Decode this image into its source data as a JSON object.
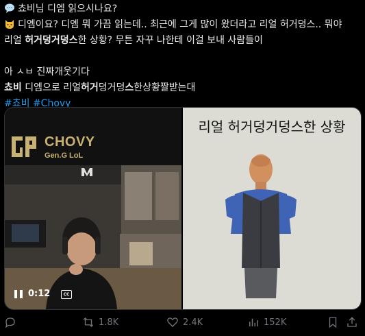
{
  "tweet": {
    "line1": "쵸비님 디엠 읽으시나요?",
    "line2": "디엠이요? 디엠 뭐 가끔 읽는데.. 최근에 그게 많이 왔더라고 리얼 허거덩스.. 뭐야",
    "line3_pre": "리얼 ",
    "line3_bold": "허거덩거덩스",
    "line3_post": "한 상황? 무튼 자꾸 나한테 이걸 보내 사람들이",
    "line4": "아 ㅅㅂ 진짜개웃기다",
    "line5_bold1": "쵸비",
    "line5_mid1": " 디엠으로 리얼",
    "line5_bold2": "허거",
    "line5_mid2": "덩거덩",
    "line5_bold3": "스",
    "line5_end": "한상황짤받는대",
    "hashtag1": "#쵸비",
    "hashtag2": "#Chovy"
  },
  "video": {
    "brand": "CHOVY",
    "team": "Gen.G LoL",
    "time": "0:12",
    "cc_label": "CC"
  },
  "meme": {
    "caption": "리얼 허거덩거덩스한 상황"
  },
  "actions": {
    "retweets": "1.8K",
    "likes": "2.4K",
    "views": "152K"
  },
  "icons": {
    "line1": "speech-bubble-icon",
    "line2": "cat-face-icon",
    "reply": "reply-icon",
    "retweet": "retweet-icon",
    "like": "heart-icon",
    "views": "views-chart-icon",
    "bookmark": "bookmark-icon",
    "share": "share-icon"
  },
  "colors": {
    "link": "#1d9bf0",
    "muted": "#71767b",
    "gold": "#c9b172"
  }
}
